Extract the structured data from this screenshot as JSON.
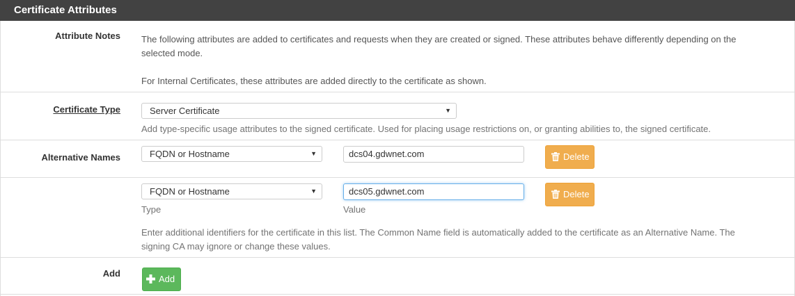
{
  "panel": {
    "title": "Certificate Attributes"
  },
  "attribute_notes": {
    "label": "Attribute Notes",
    "line1": "The following attributes are added to certificates and requests when they are created or signed. These attributes behave differently depending on the",
    "line2": "selected mode.",
    "line3": "For Internal Certificates, these attributes are added directly to the certificate as shown."
  },
  "certificate_type": {
    "label": "Certificate Type",
    "selected": "Server Certificate",
    "help": "Add type-specific usage attributes to the signed certificate. Used for placing usage restrictions on, or granting abilities to, the signed certificate."
  },
  "alternative_names": {
    "label": "Alternative Names",
    "rows": [
      {
        "type": "FQDN or Hostname",
        "value": "dcs04.gdwnet.com",
        "delete_label": "Delete"
      },
      {
        "type": "FQDN or Hostname",
        "value": "dcs05.gdwnet.com",
        "delete_label": "Delete"
      }
    ],
    "type_label": "Type",
    "value_label": "Value",
    "help_line1": "Enter additional identifiers for the certificate in this list. The Common Name field is automatically added to the certificate as an Alternative Name. The",
    "help_line2": "signing CA may ignore or change these values."
  },
  "add": {
    "label": "Add",
    "button_label": "Add"
  },
  "colors": {
    "heading_bg": "#424242",
    "delete_bg": "#f0ad4e",
    "add_bg": "#5cb85c",
    "focus_border": "#66afe9"
  },
  "icons": {
    "delete": "trash-icon",
    "add": "plus-icon",
    "dropdown": "caret-down-icon"
  }
}
